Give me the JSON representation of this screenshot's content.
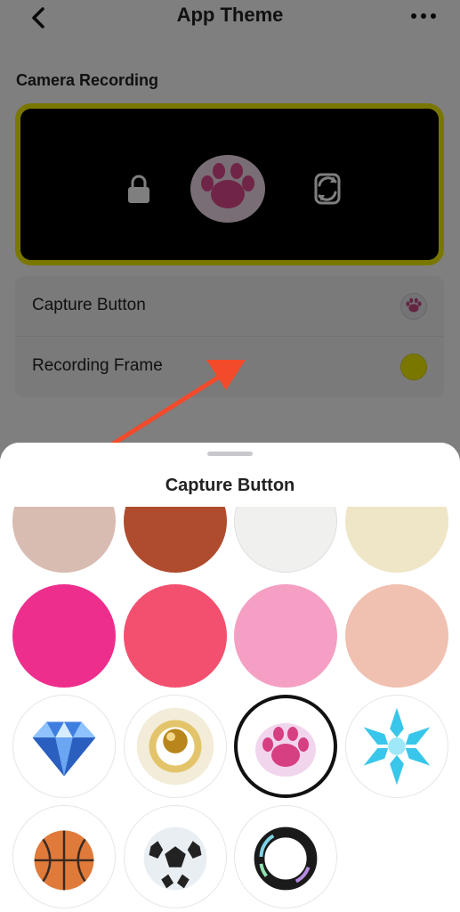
{
  "header": {
    "title": "App Theme",
    "back_icon": "chevron-left-icon",
    "more_icon": "ellipsis-icon"
  },
  "section": {
    "label": "Camera Recording"
  },
  "preview": {
    "frame_color": "#f5ef00",
    "icons": [
      "lock-icon",
      "paw-icon",
      "camera-flip-icon"
    ]
  },
  "settings": {
    "capture_button_label": "Capture Button",
    "recording_frame_label": "Recording Frame",
    "recording_frame_color": "#f5ef00"
  },
  "sheet": {
    "title": "Capture Button",
    "options": [
      {
        "name": "beige",
        "color": "#d8bcb1"
      },
      {
        "name": "rust",
        "color": "#b04c2e"
      },
      {
        "name": "off-white",
        "color": "#f0f0ee"
      },
      {
        "name": "cream",
        "color": "#efe6c8"
      },
      {
        "name": "hot-pink",
        "color": "#ee2e8d"
      },
      {
        "name": "coral-pink",
        "color": "#f3506f"
      },
      {
        "name": "light-pink",
        "color": "#f59fc4"
      },
      {
        "name": "peach",
        "color": "#f0c0b0"
      },
      {
        "name": "diamond",
        "icon": "diamond-icon"
      },
      {
        "name": "gold-orb",
        "icon": "gold-orb-icon"
      },
      {
        "name": "paw",
        "icon": "paw-icon",
        "selected": true
      },
      {
        "name": "snowflake",
        "icon": "snowflake-icon"
      },
      {
        "name": "basketball",
        "icon": "basketball-icon"
      },
      {
        "name": "soccer-ball",
        "icon": "soccer-ball-icon"
      },
      {
        "name": "holo-ring",
        "icon": "holo-ring-icon"
      }
    ]
  }
}
